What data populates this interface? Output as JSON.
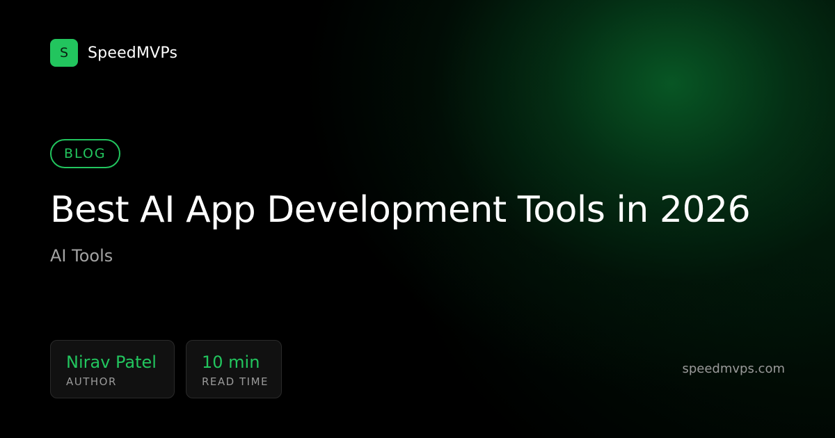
{
  "brand": {
    "logo_letter": "S",
    "name": "SpeedMVPs",
    "accent_color": "#22c55e"
  },
  "badge": {
    "label": "BLOG"
  },
  "article": {
    "title": "Best AI App Development Tools in 2026",
    "category": "AI Tools"
  },
  "stats": {
    "author": {
      "value": "Nirav Patel",
      "label": "AUTHOR"
    },
    "read_time": {
      "value": "10 min",
      "label": "READ TIME"
    }
  },
  "footer": {
    "domain": "speedmvps.com"
  }
}
